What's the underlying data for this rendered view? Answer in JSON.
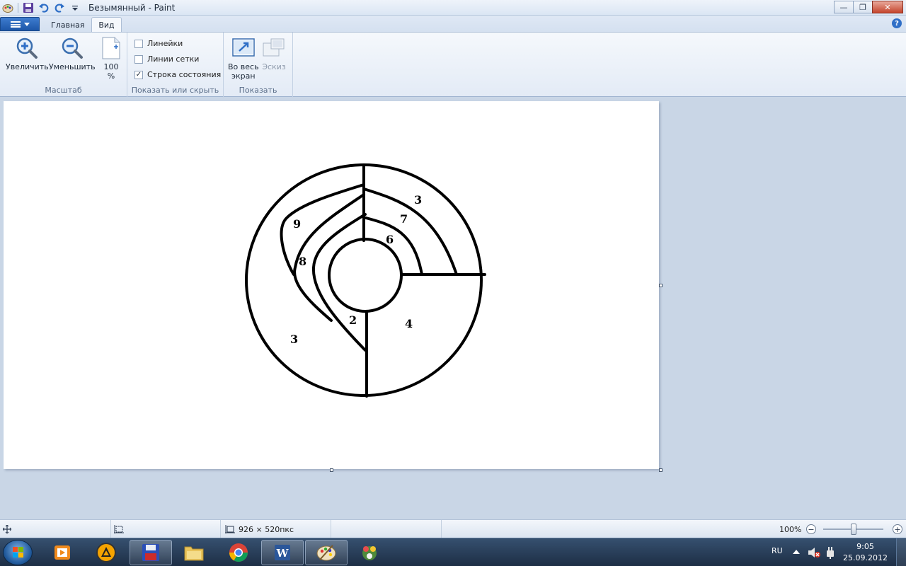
{
  "window": {
    "title": "Безымянный - Paint",
    "minimize_label": "—",
    "restore_label": "❐",
    "close_label": "✕"
  },
  "tabs": {
    "home": "Главная",
    "view": "Вид",
    "help": "?"
  },
  "ribbon": {
    "zoom_group": {
      "label": "Масштаб",
      "zoom_in": "Увеличить",
      "zoom_out": "Уменьшить",
      "zoom_100_line1": "100",
      "zoom_100_line2": "%"
    },
    "show_group": {
      "label": "Показать или скрыть",
      "rulers": {
        "label": "Линейки",
        "checked": false
      },
      "gridlines": {
        "label": "Линии сетки",
        "checked": false
      },
      "statusbar": {
        "label": "Строка состояния",
        "checked": true,
        "mark": "✓"
      }
    },
    "display_group": {
      "label": "Показать",
      "fullscreen_line1": "Во весь",
      "fullscreen_line2": "экран",
      "thumbnail": "Эскиз"
    }
  },
  "drawing": {
    "labels": [
      "3",
      "7",
      "6",
      "9",
      "8",
      "2",
      "4",
      "3"
    ]
  },
  "statusbar": {
    "image_size": "926 × 520пкс",
    "zoom": "100%",
    "zoom_out": "−",
    "zoom_in": "+"
  },
  "taskbar": {
    "language": "RU",
    "time": "9:05",
    "date": "25.09.2012"
  },
  "colors": {
    "ribbon_bg": "#e3ebf6",
    "workspace_bg": "#c9d6e6",
    "app_menu_blue": "#1d57a8",
    "taskbar_bg": "#1d2e45"
  }
}
